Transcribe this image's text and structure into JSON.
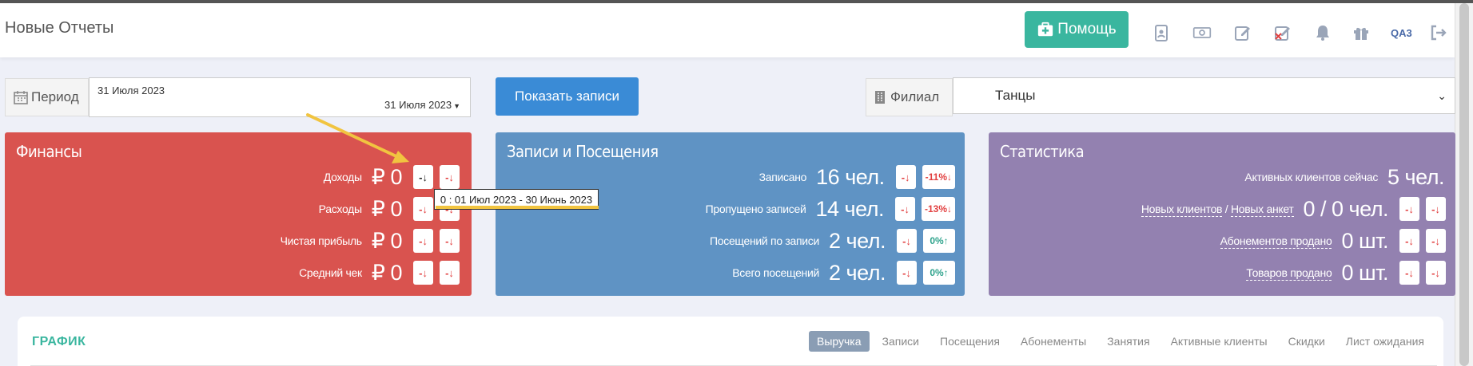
{
  "header": {
    "title": "Новые Отчеты",
    "help_label": "Помощь",
    "user_code": "QA3",
    "icons": [
      "clipboard-user-icon",
      "money-icon",
      "edit-icon",
      "edit-cancel-icon",
      "bell-icon",
      "gift-icon",
      "logout-icon"
    ]
  },
  "filters": {
    "period_label": "Период",
    "period_start": "31 Июля 2023",
    "period_end": "31 Июля 2023",
    "show_button": "Показать записи",
    "branch_label": "Филиал",
    "branch_value": "Танцы"
  },
  "finance": {
    "title": "Финансы",
    "rows": [
      {
        "label": "Доходы",
        "value": "₽ 0",
        "chip1": "-↓",
        "chip2": "-↓"
      },
      {
        "label": "Расходы",
        "value": "₽ 0",
        "chip1": "-↓",
        "chip2": "-↓"
      },
      {
        "label": "Чистая прибыль",
        "value": "₽ 0",
        "chip1": "-↓",
        "chip2": "-↓"
      },
      {
        "label": "Средний чек",
        "value": "₽ 0",
        "chip1": "-↓",
        "chip2": "-↓"
      }
    ],
    "tooltip": "0 : 01 Июл 2023 - 30 Июнь 2023"
  },
  "records": {
    "title": "Записи и Посещения",
    "rows": [
      {
        "label": "Записано",
        "value": "16 чел.",
        "chip1": "-↓",
        "chip2": "-11%↓"
      },
      {
        "label": "Пропущено записей",
        "value": "14 чел.",
        "chip1": "-↓",
        "chip2": "-13%↓"
      },
      {
        "label": "Посещений по записи",
        "value": "2 чел.",
        "chip1": "-↓",
        "chip2": "0%↑"
      },
      {
        "label": "Всего посещений",
        "value": "2 чел.",
        "chip1": "-↓",
        "chip2": "0%↑"
      }
    ]
  },
  "stats": {
    "title": "Статистика",
    "rows": [
      {
        "label": "Активных клиентов сейчас",
        "value": "5 чел."
      },
      {
        "label_a": "Новых клиентов",
        "label_sep": " / ",
        "label_b": "Новых анкет",
        "value": "0 / 0 чел.",
        "chip1": "-↓",
        "chip2": "-↓"
      },
      {
        "label": "Абонементов продано",
        "value": "0 шт.",
        "chip1": "-↓",
        "chip2": "-↓"
      },
      {
        "label": "Товаров продано",
        "value": "0 шт.",
        "chip1": "-↓",
        "chip2": "-↓"
      }
    ]
  },
  "graph": {
    "title": "ГРАФИК",
    "tabs": [
      "Выручка",
      "Записи",
      "Посещения",
      "Абонементы",
      "Занятия",
      "Активные клиенты",
      "Скидки",
      "Лист ожидания"
    ],
    "active_tab": "Выручка"
  },
  "colors": {
    "finance": "#d9534f",
    "records": "#5f93c4",
    "stats": "#9381b0",
    "help": "#3ab69f",
    "show_button": "#3a8bd6",
    "annotation_arrow": "#f1c440"
  }
}
